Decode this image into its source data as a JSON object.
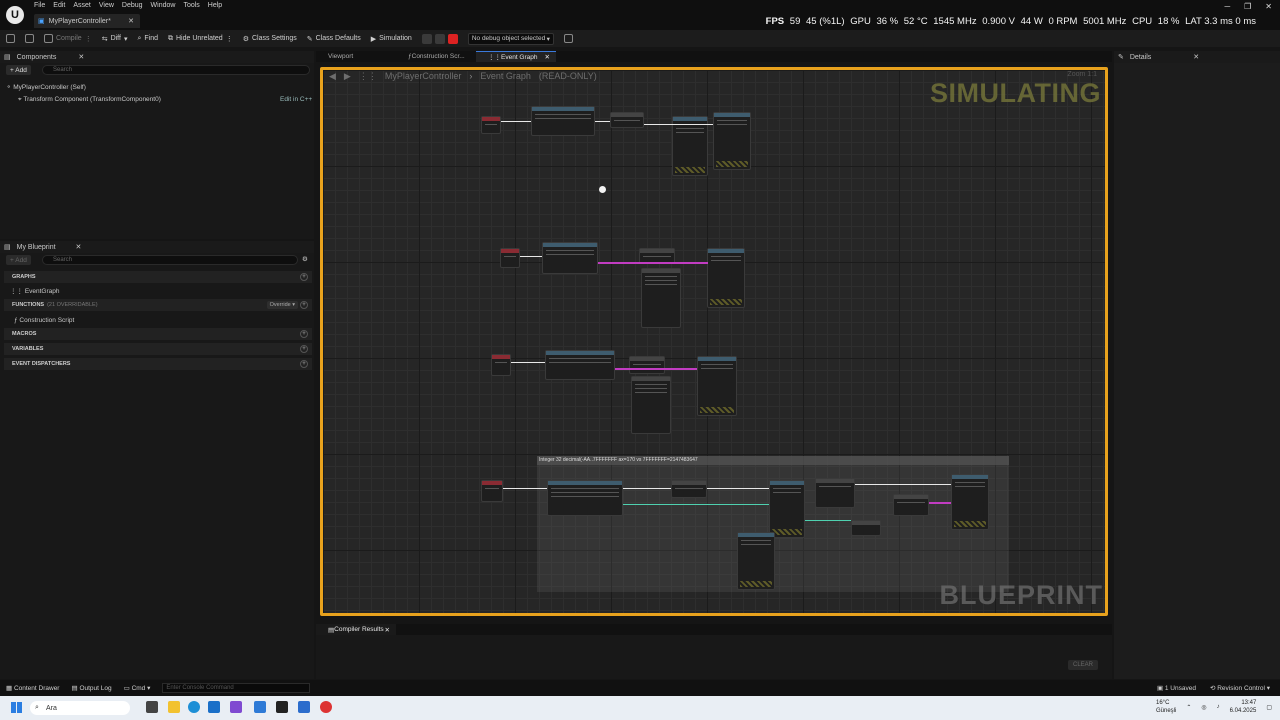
{
  "menu": [
    "File",
    "Edit",
    "Asset",
    "View",
    "Debug",
    "Window",
    "Tools",
    "Help"
  ],
  "doc_tab": {
    "label": "MyPlayerController*"
  },
  "stats": {
    "fps_label": "FPS",
    "fps": "59",
    "gpu_usage": "45 (%1L)",
    "gpu_label": "GPU",
    "gpu_load": "36 %",
    "gpu_temp": "52 °C",
    "gpu_clock": "1545 MHz",
    "gpu_volt": "0.900 V",
    "gpu_power": "44 W",
    "fan": "0 RPM",
    "mem_clock": "5001 MHz",
    "cpu_label": "CPU",
    "cpu_load": "18 %",
    "lat": "LAT 3.3 ms 0 ms"
  },
  "toolbar": {
    "compile": "Compile",
    "diff": "Diff",
    "find": "Find",
    "hide_unrelated": "Hide Unrelated",
    "class_settings": "Class Settings",
    "class_defaults": "Class Defaults",
    "simulation": "Simulation",
    "debug_select": "No debug object selected"
  },
  "components": {
    "title": "Components",
    "add": "+ Add",
    "search_placeholder": "Search",
    "self_item": "MyPlayerController (Self)",
    "transform_item": "Transform Component (TransformComponent0)",
    "edit_link": "Edit in C++"
  },
  "my_blueprint": {
    "title": "My Blueprint",
    "add": "+ Add",
    "search_placeholder": "Search",
    "graphs": "GRAPHS",
    "event_graph": "EventGraph",
    "functions": "FUNCTIONS",
    "functions_sub": "(21 OVERRIDABLE)",
    "override": "Override",
    "construction_script": "Construction Script",
    "macros": "MACROS",
    "variables": "VARIABLES",
    "dispatchers": "EVENT DISPATCHERS"
  },
  "editor_tabs": [
    "Viewport",
    "Construction Scr...",
    "Event Graph"
  ],
  "graph": {
    "crumb_root": "MyPlayerController",
    "crumb_graph": "Event Graph",
    "readonly": "(READ-ONLY)",
    "zoom": "Zoom 1:1",
    "simulating": "SIMULATING",
    "watermark": "BLUEPRINT",
    "comment_text": "Integer 32 decimal(-AA..7FFFFFFF  ax=170 vs  7FFFFFFF=2147483647"
  },
  "details": {
    "title": "Details"
  },
  "compiler": {
    "title": "Compiler Results",
    "clear": "CLEAR"
  },
  "statusbar": {
    "content_drawer": "Content Drawer",
    "output_log": "Output Log",
    "cmd": "Cmd",
    "console_placeholder": "Enter Console Command",
    "unsaved": "1 Unsaved",
    "revision": "Revision Control"
  },
  "taskbar": {
    "search": "Ara",
    "weather_temp": "16°C",
    "weather_desc": "Güneşli",
    "time": "13:47",
    "date": "6.04.2025"
  }
}
